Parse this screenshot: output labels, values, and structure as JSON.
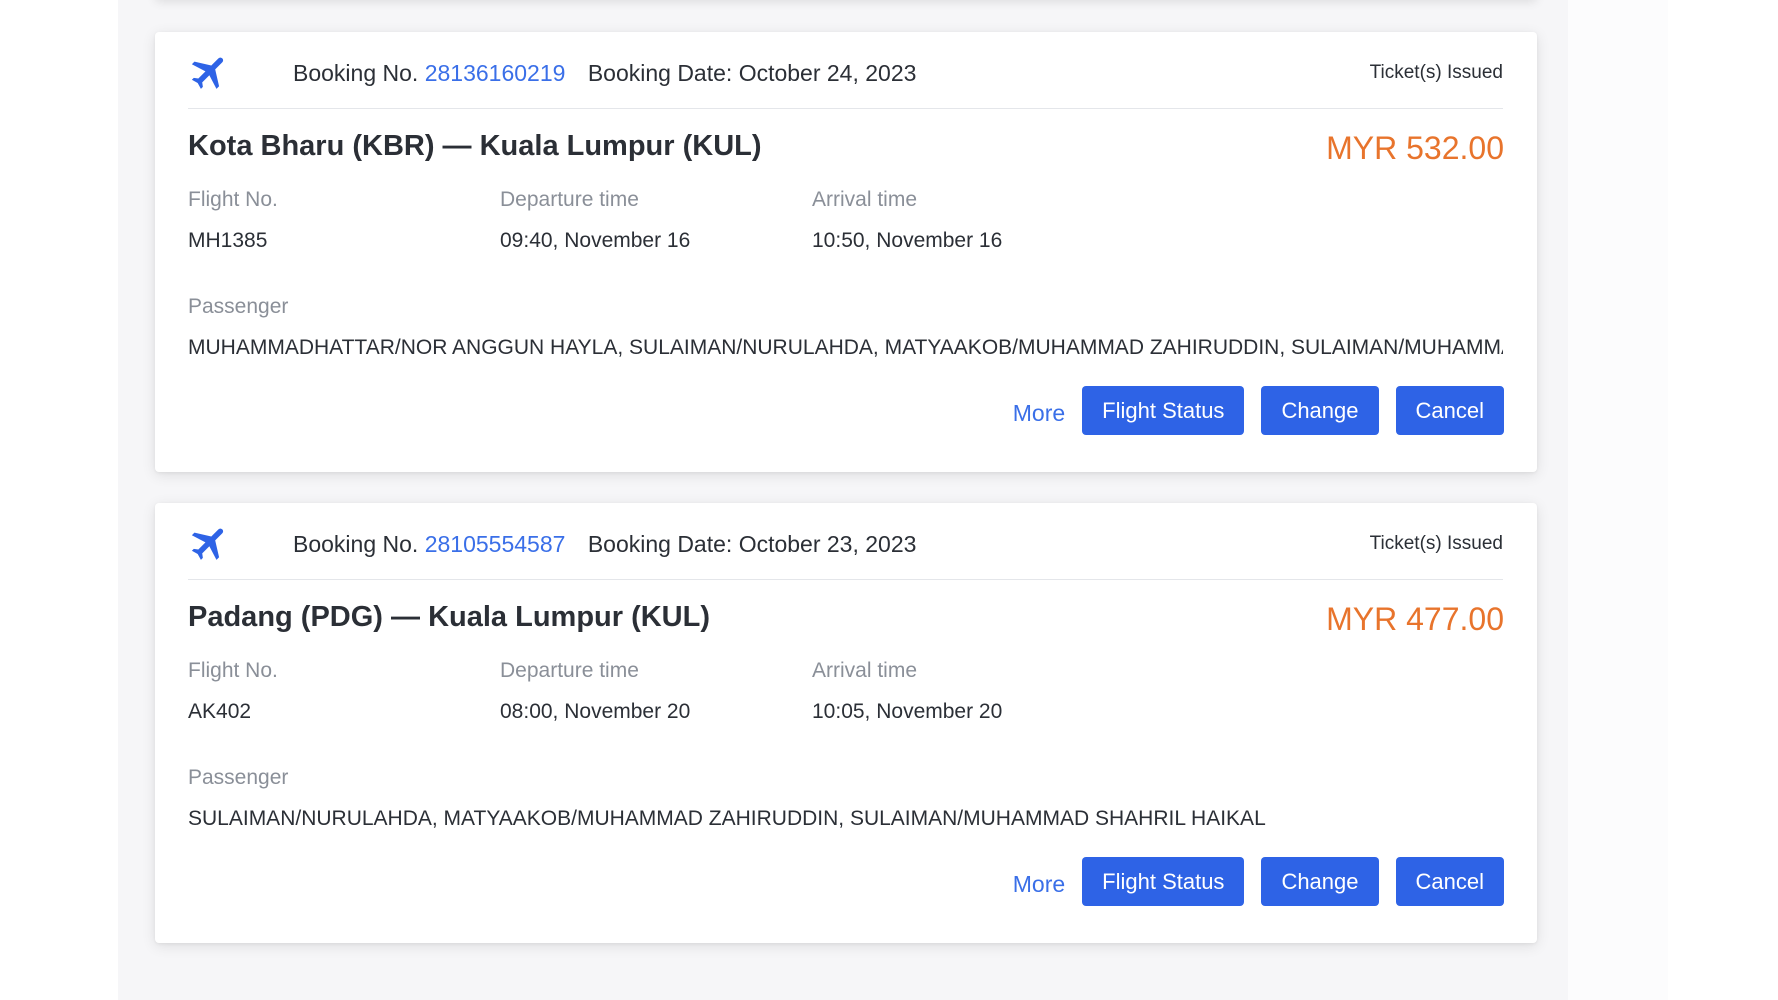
{
  "colors": {
    "accent": "#2e63e6",
    "link": "#3a6fe8",
    "price": "#e8742c",
    "label": "#8a8f98",
    "text": "#2b2f36"
  },
  "bookings": [
    {
      "icon": "airplane-icon",
      "booking_no_label": "Booking No.",
      "booking_no": "28136160219",
      "booking_date_label": "Booking Date:",
      "booking_date": "October 24, 2023",
      "status": "Ticket(s) Issued",
      "route": "Kota Bharu (KBR) — Kuala Lumpur (KUL)",
      "price": "MYR 532.00",
      "flight_no_label": "Flight No.",
      "flight_no": "MH1385",
      "departure_label": "Departure time",
      "departure": "09:40, November 16",
      "arrival_label": "Arrival time",
      "arrival": "10:50, November 16",
      "passenger_label": "Passenger",
      "passengers": "MUHAMMADHATTAR/NOR ANGGUN HAYLA, SULAIMAN/NURULAHDA, MATYAAKOB/MUHAMMAD ZAHIRUDDIN, SULAIMAN/MUHAMMAD SHAHRIL HAIKAL",
      "more_label": "More",
      "flight_status_label": "Flight Status",
      "change_label": "Change",
      "cancel_label": "Cancel"
    },
    {
      "icon": "airplane-icon",
      "booking_no_label": "Booking No.",
      "booking_no": "28105554587",
      "booking_date_label": "Booking Date:",
      "booking_date": "October 23, 2023",
      "status": "Ticket(s) Issued",
      "route": "Padang (PDG) — Kuala Lumpur (KUL)",
      "price": "MYR 477.00",
      "flight_no_label": "Flight No.",
      "flight_no": "AK402",
      "departure_label": "Departure time",
      "departure": "08:00, November 20",
      "arrival_label": "Arrival time",
      "arrival": "10:05, November 20",
      "passenger_label": "Passenger",
      "passengers": "SULAIMAN/NURULAHDA, MATYAAKOB/MUHAMMAD ZAHIRUDDIN, SULAIMAN/MUHAMMAD SHAHRIL HAIKAL",
      "more_label": "More",
      "flight_status_label": "Flight Status",
      "change_label": "Change",
      "cancel_label": "Cancel"
    }
  ]
}
